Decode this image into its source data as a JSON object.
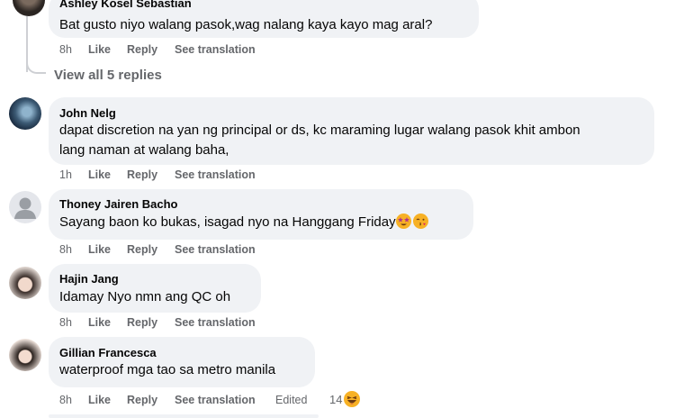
{
  "comments": [
    {
      "name": "Ashley Kosel Sebastian",
      "lines": [
        "Bat gusto niyo walang pasok,wag nalang kaya kayo mag aral?"
      ],
      "time": "8h",
      "like": "Like",
      "reply": "Reply",
      "translate": "See translation"
    },
    {
      "name": "John Nelg",
      "lines": [
        "dapat discretion na yan ng principal or ds, kc maraming lugar walang pasok khit ambon",
        "lang naman at walang baha,"
      ],
      "time": "1h",
      "like": "Like",
      "reply": "Reply",
      "translate": "See translation"
    },
    {
      "name": "Thoney Jairen Bacho",
      "lines": [
        "Sayang baon ko bukas, isagad nyo na Hanggang Friday"
      ],
      "time": "8h",
      "like": "Like",
      "reply": "Reply",
      "translate": "See translation",
      "emojis": [
        "star-struck-emoji",
        "kissing-heart-emoji"
      ]
    },
    {
      "name": "Hajin Jang",
      "lines": [
        "Idamay Nyo nmn ang QC oh"
      ],
      "time": "8h",
      "like": "Like",
      "reply": "Reply",
      "translate": "See translation"
    },
    {
      "name": "Gillian Francesca",
      "lines": [
        "waterproof mga tao sa metro manila"
      ],
      "time": "8h",
      "like": "Like",
      "reply": "Reply",
      "translate": "See translation",
      "edited": "Edited",
      "reactions": "14",
      "reaction_icon": "haha-emoji"
    }
  ],
  "view_replies": "View all 5 replies",
  "colors": {
    "bubble": "#f0f2f5",
    "meta": "#65676b",
    "text": "#050505",
    "emoji_yellow": "#f7b125"
  }
}
